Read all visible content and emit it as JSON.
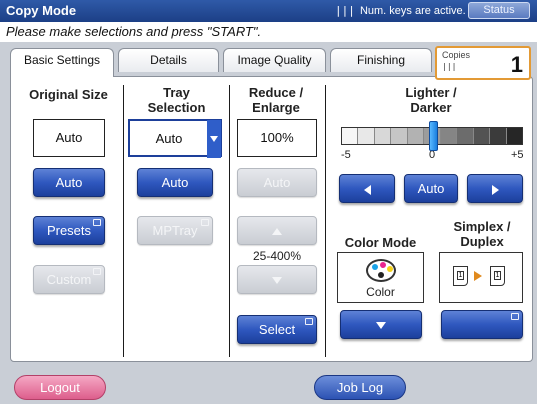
{
  "window": {
    "title": "Copy Mode",
    "numkeys_icon": "|||",
    "numkeys_text": "Num. keys are active.",
    "status_button": "Status"
  },
  "instruction": "Please make selections and press \"START\".",
  "tabs": [
    {
      "label": "Basic Settings",
      "active": true
    },
    {
      "label": "Details",
      "active": false
    },
    {
      "label": "Image Quality",
      "active": false
    },
    {
      "label": "Finishing",
      "active": false
    }
  ],
  "copies": {
    "label": "Copies",
    "icon": "|||",
    "value": "1"
  },
  "original_size": {
    "heading": "Original Size",
    "value": "Auto",
    "auto_button": "Auto",
    "presets_button": "Presets",
    "custom_button": "Custom"
  },
  "tray_selection": {
    "heading_line1": "Tray",
    "heading_line2": "Selection",
    "value": "Auto",
    "auto_button": "Auto",
    "mptray_button": "MPTray"
  },
  "reduce_enlarge": {
    "heading_line1": "Reduce /",
    "heading_line2": "Enlarge",
    "value": "100%",
    "auto_button": "Auto",
    "range": "25-400%",
    "select_button": "Select"
  },
  "lighter_darker": {
    "heading_line1": "Lighter /",
    "heading_line2": "Darker",
    "scale_min": "-5",
    "scale_mid": "0",
    "scale_max": "+5",
    "level": 0,
    "auto_button": "Auto"
  },
  "color_mode": {
    "heading": "Color Mode",
    "value": "Color"
  },
  "simplex_duplex": {
    "heading_line1": "Simplex /",
    "heading_line2": "Duplex",
    "page_a": "1",
    "page_b": "1"
  },
  "footer": {
    "logout_button": "Logout",
    "joblog_button": "Job Log"
  },
  "colors": {
    "accent": "#2f58bf",
    "title_bar": "#1c3f86",
    "copies_border": "#e39a35",
    "logout": "#dd5e8c"
  }
}
